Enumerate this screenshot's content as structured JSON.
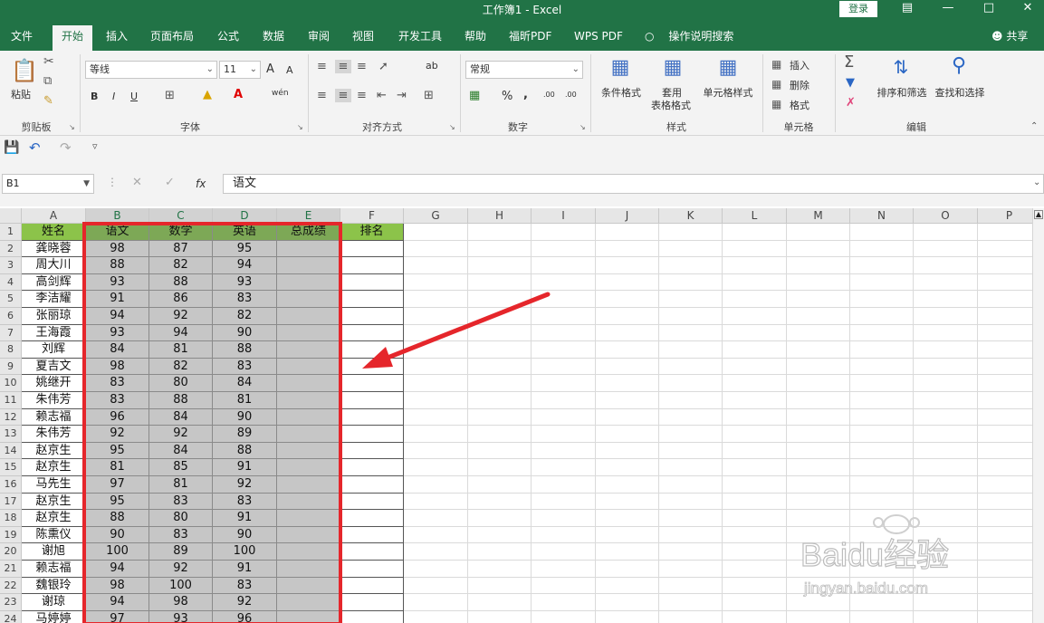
{
  "window": {
    "title": "工作簿1 - Excel",
    "login_label": "登录",
    "accent": "#217346"
  },
  "menu": {
    "tabs": [
      "文件",
      "开始",
      "插入",
      "页面布局",
      "公式",
      "数据",
      "审阅",
      "视图",
      "开发工具",
      "帮助",
      "福昕PDF",
      "WPS PDF"
    ],
    "active": "开始",
    "tell_me": "操作说明搜索",
    "share": "共享"
  },
  "ribbon": {
    "clipboard": {
      "paste": "粘贴",
      "group": "剪贴板"
    },
    "font": {
      "name": "等线",
      "size": "11",
      "bold": "B",
      "italic": "I",
      "underline": "U",
      "grow": "A",
      "shrink": "A",
      "phonetic": "wén",
      "group": "字体"
    },
    "alignment": {
      "wrap": "ab",
      "group": "对齐方式"
    },
    "number": {
      "format": "常规",
      "percent": "%",
      "comma": ",",
      "inc": ".00",
      "dec": ".00",
      "group": "数字"
    },
    "styles": {
      "conditional": "条件格式",
      "table_line1": "套用",
      "table_line2": "表格格式",
      "cell_styles": "单元格样式",
      "group": "样式"
    },
    "cells": {
      "insert": "插入",
      "delete": "删除",
      "format": "格式",
      "group": "单元格"
    },
    "editing": {
      "sort": "排序和筛选",
      "find": "查找和选择",
      "group": "编辑"
    }
  },
  "formula_bar": {
    "name_box": "B1",
    "fx": "fx",
    "content": "语文"
  },
  "grid": {
    "columns": [
      "A",
      "B",
      "C",
      "D",
      "E",
      "F",
      "G",
      "H",
      "I",
      "J",
      "K",
      "L",
      "M",
      "N",
      "O",
      "P"
    ],
    "selected_columns": [
      "B",
      "C",
      "D",
      "E"
    ],
    "headers": [
      "姓名",
      "语文",
      "数学",
      "英语",
      "总成绩",
      "排名"
    ],
    "rows": [
      [
        "龚晓蓉",
        "98",
        "87",
        "95"
      ],
      [
        "周大川",
        "88",
        "82",
        "94"
      ],
      [
        "高剑辉",
        "93",
        "88",
        "93"
      ],
      [
        "李洁耀",
        "91",
        "86",
        "83"
      ],
      [
        "张丽琼",
        "94",
        "92",
        "82"
      ],
      [
        "王海霞",
        "93",
        "94",
        "90"
      ],
      [
        "刘辉",
        "84",
        "81",
        "88"
      ],
      [
        "夏吉文",
        "98",
        "82",
        "83"
      ],
      [
        "姚继开",
        "83",
        "80",
        "84"
      ],
      [
        "朱伟芳",
        "83",
        "88",
        "81"
      ],
      [
        "赖志福",
        "96",
        "84",
        "90"
      ],
      [
        "朱伟芳",
        "92",
        "92",
        "89"
      ],
      [
        "赵京生",
        "95",
        "84",
        "88"
      ],
      [
        "赵京生",
        "81",
        "85",
        "91"
      ],
      [
        "马先生",
        "97",
        "81",
        "92"
      ],
      [
        "赵京生",
        "95",
        "83",
        "83"
      ],
      [
        "赵京生",
        "88",
        "80",
        "91"
      ],
      [
        "陈熏仪",
        "90",
        "83",
        "90"
      ],
      [
        "谢旭",
        "100",
        "89",
        "100"
      ],
      [
        "赖志福",
        "94",
        "92",
        "91"
      ],
      [
        "魏银玲",
        "98",
        "100",
        "83"
      ],
      [
        "谢琼",
        "94",
        "98",
        "92"
      ],
      [
        "马婷婷",
        "97",
        "93",
        "96"
      ]
    ]
  },
  "watermark": {
    "brand": "Baidu经验",
    "url": "jingyan.baidu.com"
  }
}
